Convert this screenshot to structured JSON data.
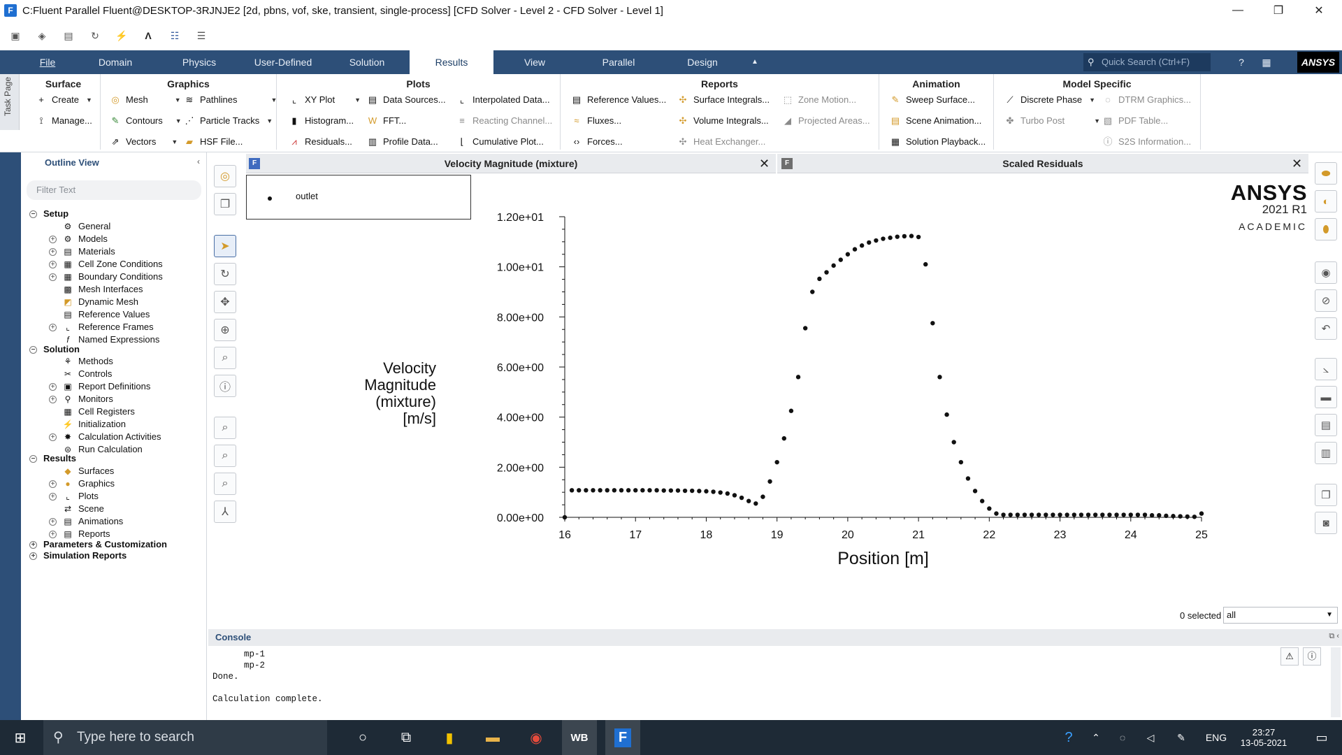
{
  "window": {
    "title": "C:Fluent Parallel Fluent@DESKTOP-3RJNJE2  [2d, pbns, vof, ske, transient, single-process] [CFD Solver - Level 2 - CFD Solver - Level 1]",
    "app_icon": "F",
    "minimize": "—",
    "restore": "❐",
    "close": "✕"
  },
  "tabs": [
    "File",
    "Domain",
    "Physics",
    "User-Defined",
    "Solution",
    "Results",
    "View",
    "Parallel",
    "Design"
  ],
  "active_tab": "Results",
  "quick_search": {
    "placeholder": "Quick Search (Ctrl+F)"
  },
  "brand": "ANSYS",
  "task_page_label": "Task Page",
  "ribbon": {
    "surface": {
      "title": "Surface",
      "items": [
        "Create",
        "Manage..."
      ]
    },
    "graphics": {
      "title": "Graphics",
      "items": [
        "Mesh",
        "Contours",
        "Vectors",
        "Pathlines",
        "Particle Tracks",
        "HSF File..."
      ]
    },
    "plots": {
      "title": "Plots",
      "items": [
        "XY Plot",
        "Histogram...",
        "Residuals...",
        "Data Sources...",
        "FFT...",
        "Profile Data...",
        "Interpolated Data...",
        "Reacting Channel...",
        "Cumulative Plot..."
      ]
    },
    "reports": {
      "title": "Reports",
      "items": [
        "Reference Values...",
        "Fluxes...",
        "Forces...",
        "Surface Integrals...",
        "Volume Integrals...",
        "Heat Exchanger...",
        "Zone Motion...",
        "Projected Areas..."
      ]
    },
    "animation": {
      "title": "Animation",
      "items": [
        "Sweep Surface...",
        "Scene Animation...",
        "Solution Playback..."
      ]
    },
    "model_specific": {
      "title": "Model Specific",
      "items": [
        "Discrete Phase",
        "Turbo Post",
        "DTRM Graphics...",
        "PDF Table...",
        "S2S Information..."
      ]
    }
  },
  "outline": {
    "title": "Outline View",
    "filter_placeholder": "Filter Text",
    "setup": {
      "label": "Setup",
      "items": [
        "General",
        "Models",
        "Materials",
        "Cell Zone Conditions",
        "Boundary Conditions",
        "Mesh Interfaces",
        "Dynamic Mesh",
        "Reference Values",
        "Reference Frames",
        "Named Expressions"
      ]
    },
    "solution": {
      "label": "Solution",
      "items": [
        "Methods",
        "Controls",
        "Report Definitions",
        "Monitors",
        "Cell Registers",
        "Initialization",
        "Calculation Activities",
        "Run Calculation"
      ]
    },
    "results": {
      "label": "Results",
      "items": [
        "Surfaces",
        "Graphics",
        "Plots",
        "Scene",
        "Animations",
        "Reports"
      ]
    },
    "params": "Parameters & Customization",
    "sim_reports": "Simulation Reports"
  },
  "panels": {
    "left_title": "Velocity Magnitude (mixture)",
    "right_title": "Scaled Residuals",
    "badge": "F",
    "close": "✕"
  },
  "watermark": {
    "name": "ANSYS",
    "version": "2021 R1",
    "edition": "ACADEMIC"
  },
  "selection": {
    "count": "0 selected",
    "filter": "all"
  },
  "console": {
    "title": "Console",
    "lines": "      mp-1\n      mp-2\nDone.\n\nCalculation complete."
  },
  "taskbar": {
    "search_placeholder": "Type here to search",
    "lang": "ENG",
    "time": "23:27",
    "date": "13-05-2021",
    "wb_label": "WB",
    "fluent_label": "F"
  },
  "chart_data": {
    "type": "scatter",
    "title": "",
    "xlabel": "Position [m]",
    "ylabel": "Velocity Magnitude (mixture) [m/s]",
    "ylabel_lines": [
      "Velocity",
      "Magnitude",
      "(mixture)",
      "[m/s]"
    ],
    "xlim": [
      16,
      25
    ],
    "ylim": [
      0,
      12
    ],
    "x_ticks": [
      "16",
      "17",
      "18",
      "19",
      "20",
      "21",
      "22",
      "23",
      "24",
      "25"
    ],
    "y_ticks": [
      "0.00e+00",
      "2.00e+00",
      "4.00e+00",
      "6.00e+00",
      "8.00e+00",
      "1.00e+01",
      "1.20e+01"
    ],
    "series": [
      {
        "name": "outlet",
        "color": "#111111",
        "x": [
          16.0,
          16.1,
          16.2,
          16.3,
          16.4,
          16.5,
          16.6,
          16.7,
          16.8,
          16.9,
          17.0,
          17.1,
          17.2,
          17.3,
          17.4,
          17.5,
          17.6,
          17.7,
          17.8,
          17.9,
          18.0,
          18.1,
          18.2,
          18.3,
          18.4,
          18.5,
          18.6,
          18.7,
          18.8,
          18.9,
          19.0,
          19.1,
          19.2,
          19.3,
          19.4,
          19.5,
          19.6,
          19.7,
          19.8,
          19.9,
          20.0,
          20.1,
          20.2,
          20.3,
          20.4,
          20.5,
          20.6,
          20.7,
          20.8,
          20.9,
          21.0,
          21.1,
          21.2,
          21.3,
          21.4,
          21.5,
          21.6,
          21.7,
          21.8,
          21.9,
          22.0,
          22.1,
          22.2,
          22.3,
          22.4,
          22.5,
          22.6,
          22.7,
          22.8,
          22.9,
          23.0,
          23.1,
          23.2,
          23.3,
          23.4,
          23.5,
          23.6,
          23.7,
          23.8,
          23.9,
          24.0,
          24.1,
          24.2,
          24.3,
          24.4,
          24.5,
          24.6,
          24.7,
          24.8,
          24.9,
          25.0
        ],
        "y": [
          0.0,
          1.08,
          1.08,
          1.08,
          1.08,
          1.08,
          1.08,
          1.08,
          1.08,
          1.08,
          1.08,
          1.08,
          1.08,
          1.08,
          1.07,
          1.07,
          1.07,
          1.06,
          1.06,
          1.05,
          1.04,
          1.02,
          0.99,
          0.95,
          0.88,
          0.78,
          0.65,
          0.55,
          0.82,
          1.43,
          2.2,
          3.15,
          4.25,
          5.6,
          7.55,
          9.0,
          9.52,
          9.78,
          10.05,
          10.28,
          10.5,
          10.7,
          10.85,
          10.97,
          11.05,
          11.12,
          11.16,
          11.2,
          11.22,
          11.23,
          11.19,
          10.1,
          7.75,
          5.6,
          4.1,
          3.0,
          2.2,
          1.55,
          1.05,
          0.65,
          0.35,
          0.15,
          0.1,
          0.1,
          0.1,
          0.1,
          0.1,
          0.1,
          0.1,
          0.1,
          0.1,
          0.1,
          0.1,
          0.1,
          0.1,
          0.1,
          0.1,
          0.1,
          0.1,
          0.1,
          0.1,
          0.1,
          0.1,
          0.08,
          0.08,
          0.06,
          0.05,
          0.04,
          0.03,
          0.02,
          0.15
        ]
      }
    ],
    "legend": "top-left",
    "grid": false
  }
}
